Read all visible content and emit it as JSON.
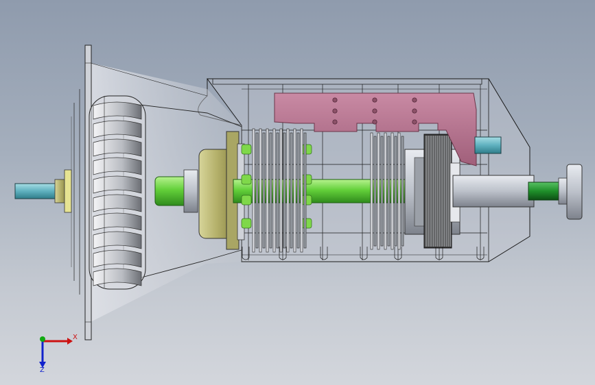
{
  "viewport": {
    "background_top": "#8f9bad",
    "background_bottom": "#d3d6dc"
  },
  "model": {
    "parts": [
      {
        "name": "input-shaft",
        "color": "#6ab7c2"
      },
      {
        "name": "torque-converter",
        "color": "#c8c8cc"
      },
      {
        "name": "pump-housing",
        "color": "#b7b46a"
      },
      {
        "name": "main-shaft",
        "color": "#66d23c"
      },
      {
        "name": "control-valve-body",
        "color": "#b8728e"
      },
      {
        "name": "planetary-gearset",
        "color": "#3a3a3a"
      },
      {
        "name": "oil-cooler-pipe",
        "color": "#7ab3c9"
      },
      {
        "name": "output-shaft",
        "color": "#1f8f2a"
      },
      {
        "name": "output-flange",
        "color": "#cfd2d8"
      }
    ]
  },
  "triad": {
    "x_label": "X",
    "z_label": "Z",
    "x_color": "#cc1111",
    "y_color": "#11aa11",
    "z_color": "#1122cc"
  }
}
